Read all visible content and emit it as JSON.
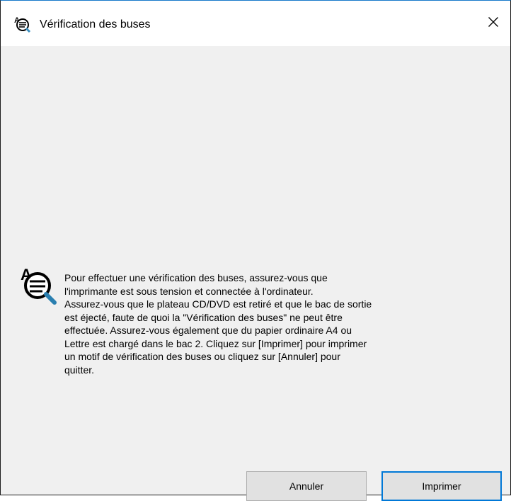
{
  "window": {
    "title": "Vérification des buses",
    "title_icon": "nozzle-check-icon",
    "close_icon": "close-icon"
  },
  "dialog": {
    "icon": "nozzle-check-icon",
    "message": "Pour effectuer une vérification des buses, assurez-vous que\nl'imprimante est sous tension et connectée à l'ordinateur.\nAssurez-vous que le plateau CD/DVD est retiré et que le bac de sortie\nest éjecté, faute de quoi la \"Vérification des buses\" ne peut être\neffectuée. Assurez-vous également que du papier ordinaire A4 ou\nLettre est chargé dans le bac 2. Cliquez sur [Imprimer] pour imprimer\nun motif de vérification des buses ou cliquez sur [Annuler] pour\nquitter."
  },
  "buttons": {
    "cancel_label": "Annuler",
    "print_label": "Imprimer"
  },
  "colors": {
    "title_bar": "#ffffff",
    "body": "#f0f0f0",
    "button": "#e1e1e1",
    "default_button_border": "#0078d7"
  }
}
